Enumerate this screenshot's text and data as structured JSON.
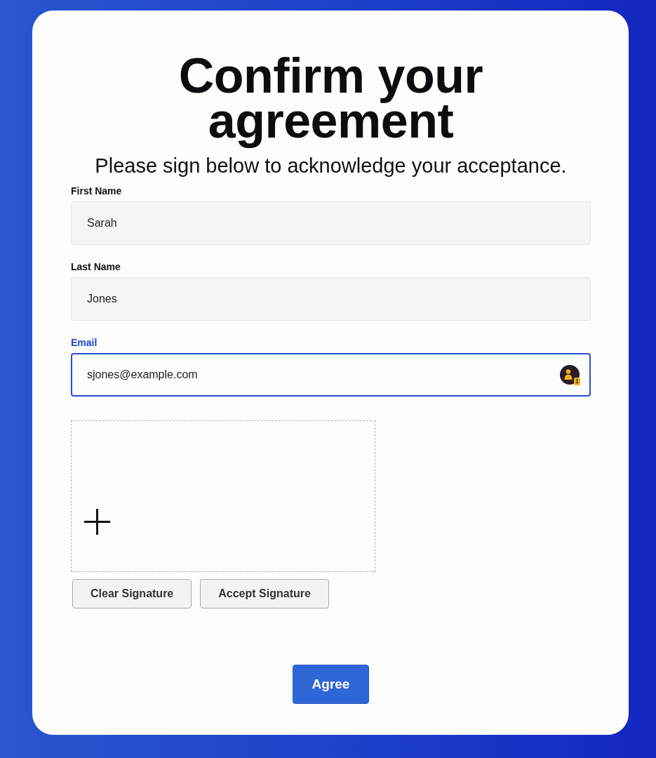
{
  "title": "Confirm your agreement",
  "subtitle": "Please sign below to acknowledge your acceptance.",
  "fields": [
    {
      "label": "First Name",
      "value": "Sarah",
      "focused": false
    },
    {
      "label": "Last Name",
      "value": "Jones",
      "focused": false
    },
    {
      "label": "Email",
      "value": "sjones@example.com",
      "focused": true,
      "autofill_badge": "1"
    }
  ],
  "signature_buttons": [
    "Clear Signature",
    "Accept Signature"
  ],
  "submit": "Agree"
}
